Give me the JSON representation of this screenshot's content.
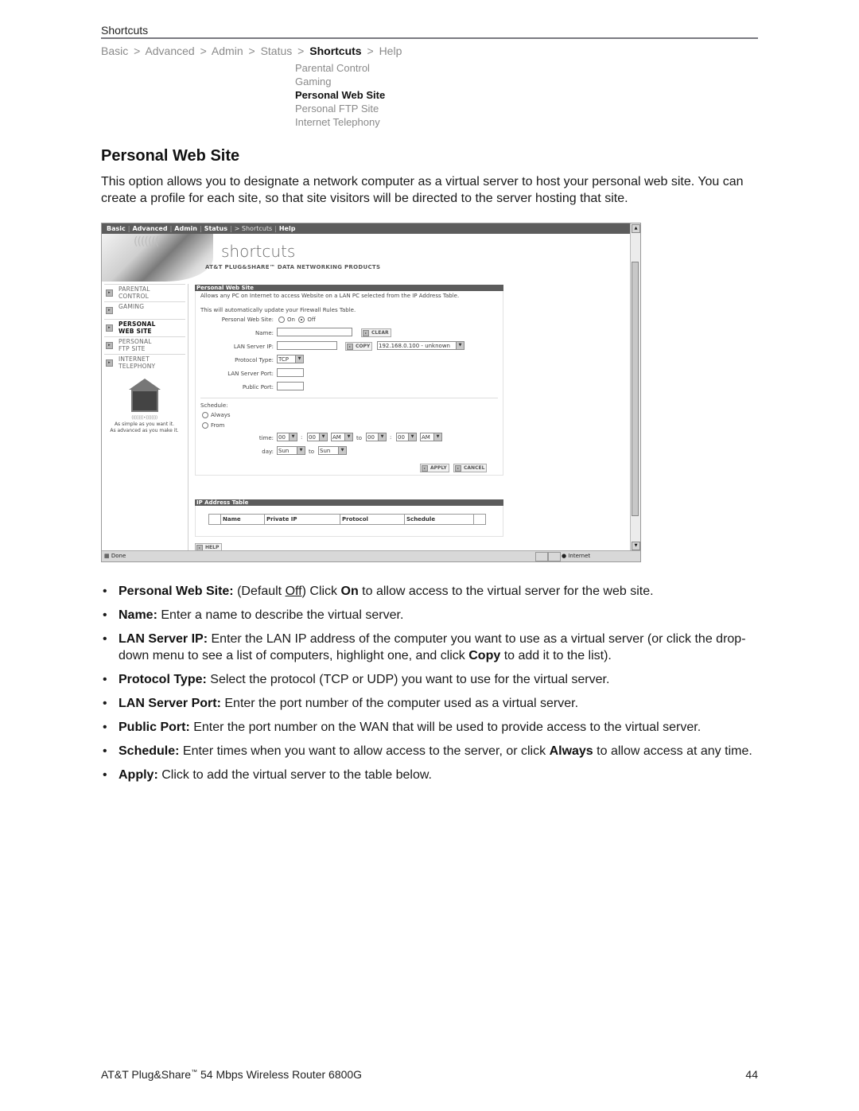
{
  "section": {
    "header": "Shortcuts"
  },
  "breadcrumb": {
    "items": [
      "Basic",
      "Advanced",
      "Admin",
      "Status",
      "Shortcuts",
      "Help"
    ],
    "separator": ">",
    "current": "Shortcuts"
  },
  "submenu": {
    "items": [
      "Parental Control",
      "Gaming",
      "Personal Web Site",
      "Personal FTP Site",
      "Internet Telephony"
    ],
    "active": "Personal Web Site"
  },
  "page": {
    "title": "Personal Web Site",
    "intro": "This option allows you to designate a network computer as a virtual server to host your personal web site. You can create a profile for each site, so that site visitors will be directed to the server hosting that site."
  },
  "screenshot": {
    "topnav": [
      "Basic",
      "Advanced",
      "Admin",
      "Status",
      "> Shortcuts",
      "Help"
    ],
    "banner": {
      "brand": "shortcuts",
      "tagline": "AT&T PLUG&SHARE™ DATA NETWORKING PRODUCTS"
    },
    "leftnav": [
      {
        "line1": "PARENTAL",
        "line2": "CONTROL",
        "active": false
      },
      {
        "line1": "GAMING",
        "line2": "",
        "active": false
      },
      {
        "line1": "PERSONAL",
        "line2": "WEB SITE",
        "active": true
      },
      {
        "line1": "PERSONAL",
        "line2": "FTP SITE",
        "active": false
      },
      {
        "line1": "INTERNET",
        "line2": "TELEPHONY",
        "active": false
      }
    ],
    "logo": {
      "rings": "((((((((•))))))))",
      "line1": "As simple as you want it.",
      "line2": "As advanced as you make it.",
      "tm": "TM"
    },
    "panel": {
      "header": "Personal Web Site",
      "desc": "Allows any PC on Internet to access Website on a LAN PC selected from the IP Address Table.",
      "note": "This will automatically update your Firewall Rules Table.",
      "personal_web_site_label": "Personal Web Site:",
      "on_label": "On",
      "off_label": "Off",
      "selected": "Off",
      "name_label": "Name:",
      "name_value": "",
      "clear_label": "CLEAR",
      "lan_ip_label": "LAN Server IP:",
      "lan_ip_value": "",
      "copy_label": "COPY",
      "ip_select": "192.168.0.100 - unknown",
      "protocol_label": "Protocol Type:",
      "protocol_value": "TCP",
      "lan_port_label": "LAN Server Port:",
      "lan_port_value": "",
      "public_port_label": "Public Port:",
      "public_port_value": "",
      "schedule_label": "Schedule:",
      "always_label": "Always",
      "from_label": "From",
      "time_label": "time:",
      "time_from_h": "00",
      "time_from_m": "00",
      "time_from_ampm": "AM",
      "to_label": "to",
      "time_to_h": "00",
      "time_to_m": "00",
      "time_to_ampm": "AM",
      "colon": ":",
      "day_label": "day:",
      "day_from": "Sun",
      "day_to": "Sun",
      "apply_label": "APPLY",
      "cancel_label": "CANCEL"
    },
    "ip_table": {
      "header": "IP Address Table",
      "columns": [
        "Name",
        "Private IP",
        "Protocol",
        "Schedule"
      ]
    },
    "help_label": "HELP",
    "status": {
      "text": "Done",
      "zone": "Internet"
    }
  },
  "bullets": [
    {
      "term": "Personal Web Site:",
      "parts": [
        " (Default ",
        {
          "u": "Off"
        },
        ") Click ",
        {
          "b": "On"
        },
        " to allow access to the virtual server for the web site."
      ]
    },
    {
      "term": "Name:",
      "parts": [
        " Enter a name to describe the virtual server."
      ]
    },
    {
      "term": "LAN Server IP:",
      "parts": [
        " Enter the LAN IP address of the computer you want to use as a virtual server (or click the drop-down menu to see a list of computers, highlight one, and click ",
        {
          "b": "Copy"
        },
        " to add it to the list)."
      ]
    },
    {
      "term": "Protocol Type:",
      "parts": [
        " Select the protocol (TCP or UDP) you want to use for the virtual server."
      ]
    },
    {
      "term": "LAN Server Port:",
      "parts": [
        " Enter the port number of the computer used as a virtual server."
      ]
    },
    {
      "term": "Public Port:",
      "parts": [
        " Enter the port number on the WAN that will be used to provide access to the virtual server."
      ]
    },
    {
      "term": "Schedule:",
      "parts": [
        " Enter times when you want to allow access to the server, or click ",
        {
          "b": "Always"
        },
        " to allow access at any time."
      ]
    },
    {
      "term": "Apply:",
      "parts": [
        " Click to add the virtual server to the table below."
      ]
    }
  ],
  "bullet_glyph": "•",
  "footer": {
    "product_pre": "AT&T Plug&Share",
    "tm": "™",
    "product_post": " 54 Mbps Wireless Router 6800G",
    "page_number": "44"
  }
}
